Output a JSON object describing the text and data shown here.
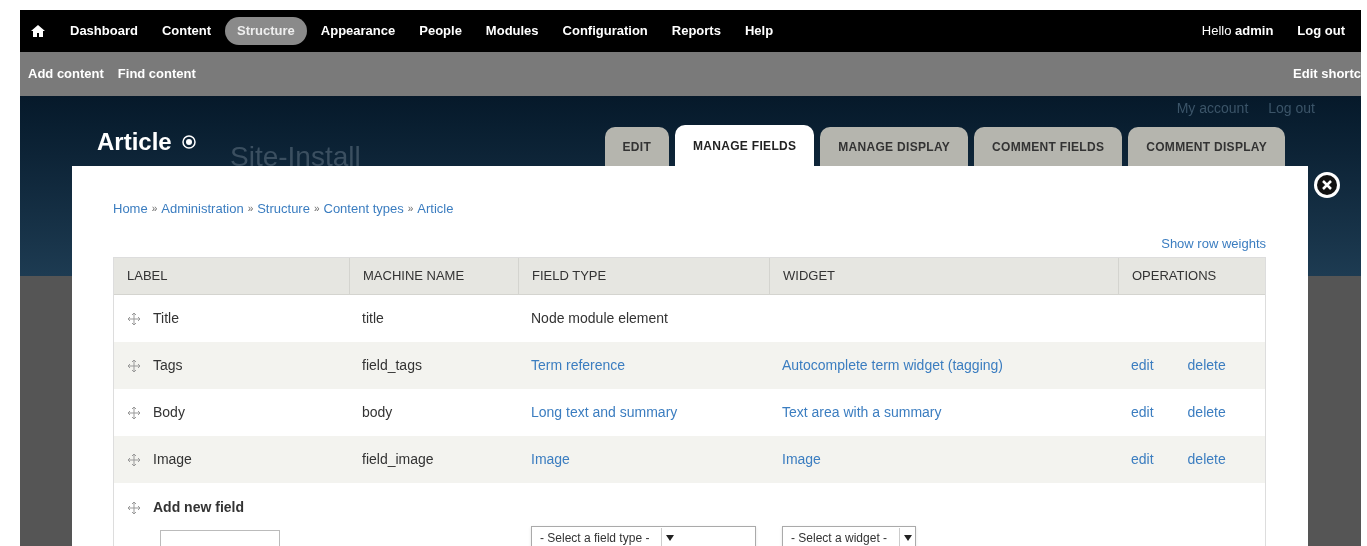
{
  "toolbar": {
    "items": [
      {
        "label": "Dashboard",
        "selected": false
      },
      {
        "label": "Content",
        "selected": false
      },
      {
        "label": "Structure",
        "selected": true
      },
      {
        "label": "Appearance",
        "selected": false
      },
      {
        "label": "People",
        "selected": false
      },
      {
        "label": "Modules",
        "selected": false
      },
      {
        "label": "Configuration",
        "selected": false
      },
      {
        "label": "Reports",
        "selected": false
      },
      {
        "label": "Help",
        "selected": false
      }
    ],
    "greeting": "Hello **admin**",
    "logout": "Log out"
  },
  "shortcuts": {
    "items": [
      "Add content",
      "Find content"
    ],
    "edit": "Edit shortc"
  },
  "site": {
    "name": "Site-Install",
    "links": [
      "My account",
      "Log out"
    ]
  },
  "overlay": {
    "title": "Article",
    "tabs": [
      {
        "label": "EDIT",
        "selected": false
      },
      {
        "label": "MANAGE FIELDS",
        "selected": true
      },
      {
        "label": "MANAGE DISPLAY",
        "selected": false
      },
      {
        "label": "COMMENT FIELDS",
        "selected": false
      },
      {
        "label": "COMMENT DISPLAY",
        "selected": false
      }
    ],
    "breadcrumb": [
      "Home",
      "Administration",
      "Structure",
      "Content types",
      "Article"
    ],
    "breadcrumb_separator": "»",
    "show_row_weights": "Show row weights",
    "table": {
      "columns": [
        "LABEL",
        "MACHINE NAME",
        "FIELD TYPE",
        "WIDGET",
        "OPERATIONS"
      ],
      "rows": [
        {
          "label": "Title",
          "machine_name": "title",
          "field_type": "Node module element",
          "field_type_link": false,
          "widget": "",
          "operations": []
        },
        {
          "label": "Tags",
          "machine_name": "field_tags",
          "field_type": "Term reference",
          "field_type_link": true,
          "widget": "Autocomplete term widget (tagging)",
          "operations": [
            "edit",
            "delete"
          ]
        },
        {
          "label": "Body",
          "machine_name": "body",
          "field_type": "Long text and summary",
          "field_type_link": true,
          "widget": "Text area with a summary",
          "operations": [
            "edit",
            "delete"
          ]
        },
        {
          "label": "Image",
          "machine_name": "field_image",
          "field_type": "Image",
          "field_type_link": true,
          "widget": "Image",
          "operations": [
            "edit",
            "delete"
          ]
        }
      ],
      "add_row": {
        "label": "Add new field",
        "field_type_select": "- Select a field type -",
        "widget_select": "- Select a widget -"
      }
    }
  }
}
